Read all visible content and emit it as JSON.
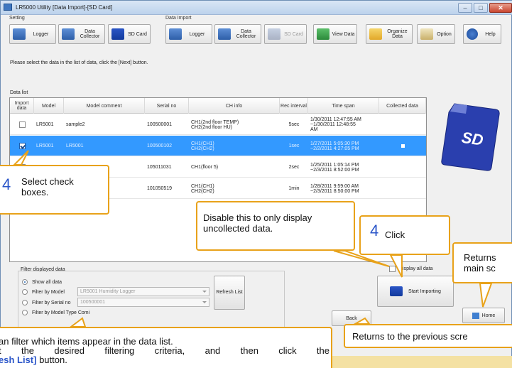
{
  "window": {
    "title": "LR5000 Utility [Data Import]-[SD Card]"
  },
  "toolbar": {
    "setting_label": "Setting",
    "data_import_label": "Data Import",
    "buttons": [
      {
        "label": "Logger",
        "icon": "logger-icon"
      },
      {
        "label": "Data Collector",
        "icon": "data-collector-icon"
      },
      {
        "label": "SD Card",
        "icon": "sd-card-icon"
      },
      {
        "label": "Logger",
        "icon": "logger-import-icon"
      },
      {
        "label": "Data Collector",
        "icon": "data-collector-import-icon"
      },
      {
        "label": "SD Card",
        "icon": "sd-card-import-icon"
      },
      {
        "label": "View Data",
        "icon": "view-data-icon"
      },
      {
        "label": "Organize Data",
        "icon": "folder-icon"
      },
      {
        "label": "Option",
        "icon": "option-icon"
      },
      {
        "label": "Help",
        "icon": "help-icon"
      }
    ]
  },
  "instruction": "Please select the data in the list of data, click the [Next] button.",
  "data_list": {
    "label": "Data list",
    "columns": [
      "Import data",
      "Model",
      "Model comment",
      "Serial no",
      "CH info",
      "Rec interval",
      "Time span",
      "Collected data"
    ],
    "rows": [
      {
        "checked": false,
        "model": "LR5001",
        "comment": "sample2",
        "serial": "100500001",
        "ch_info": "CH1(2nd floor TEMP)\nCH2(2nd floor HU)",
        "interval": "5sec",
        "time_span": "1/30/2011 12:47:55 AM\n~1/30/2011 12:48:55\nAM",
        "collected": false
      },
      {
        "checked": true,
        "model": "LR5001",
        "comment": "LR5001",
        "serial": "100500102",
        "ch_info": "CH1(CH1)\nCH2(CH2)",
        "interval": "1sec",
        "time_span": "1/27/2011 5:05:30 PM\n~2/2/2011 4:27:05 PM",
        "collected": true
      },
      {
        "checked": false,
        "model": "",
        "comment": "",
        "serial": "105011031",
        "ch_info": "CH1(floor 5)",
        "interval": "2sec",
        "time_span": "1/25/2011 1:05:14 PM\n~2/3/2011 8:52:00 PM",
        "collected": false
      },
      {
        "checked": false,
        "model": "",
        "comment": "",
        "serial": "101050519",
        "ch_info": "CH1(CH1)\nCH2(CH2)",
        "interval": "1min",
        "time_span": "1/28/2011 9:59:00 AM\n~2/3/2011 8:50:00 PM",
        "collected": false
      }
    ]
  },
  "filter": {
    "title": "Filter displayed data",
    "options": [
      "Show all data",
      "Filter by Model",
      "Filter by Serial no",
      "Filter by Model Type Comi"
    ],
    "model_value": "LR5001 Humidity Logger",
    "serial_value": "100500001",
    "refresh_label": "Refresh List"
  },
  "display_all_label": "Display all data",
  "buttons": {
    "start_importing": "Start Importing",
    "back": "Back",
    "home": "Home"
  },
  "callouts": {
    "select_num": "4",
    "select_text": "Select check boxes.",
    "disable_text": "Disable this to only display uncollected data.",
    "click_num": "4",
    "click_text": "Click",
    "returns_main": "Returns\nmain sc",
    "returns_prev": "Returns to the previous scre",
    "filter_l1": "an filter which items appear in the data list.",
    "filter_l2": "t  the  desired  filtering  criteria,  and  then  click  the",
    "filter_l3_bold": "esh List]",
    "filter_l3_rest": " button."
  },
  "colors": {
    "accent": "#e8a21a",
    "selection": "#3399ff",
    "callout_number": "#2b56c9"
  }
}
